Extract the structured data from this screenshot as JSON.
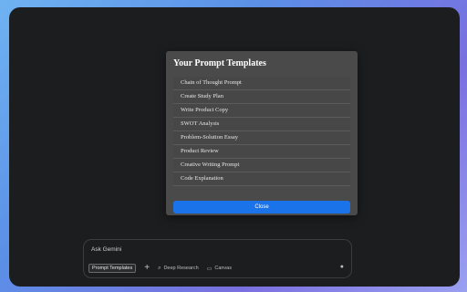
{
  "modal": {
    "title": "Your Prompt Templates",
    "templates": [
      "Chain of Thought Prompt",
      "Create Study Plan",
      "Write Product Copy",
      "SWOT Analysis",
      "Problem-Solution Essay",
      "Product Review",
      "Creative Writing Prompt",
      "Code Explanation"
    ],
    "close_label": "Close"
  },
  "composer": {
    "placeholder": "Ask Gemini",
    "prompt_templates_label": "Prompt Templates",
    "plus_icon": "plus-icon",
    "deep_research_label": "Deep Research",
    "canvas_label": "Canvas",
    "mic_icon": "microphone-icon"
  },
  "colors": {
    "accent": "#1a73e8",
    "modal_bg": "#4a4a4b",
    "window_bg": "#1c1d1f"
  }
}
